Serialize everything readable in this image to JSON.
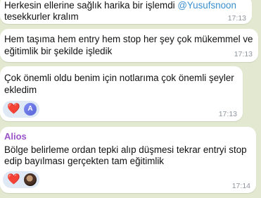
{
  "messages": [
    {
      "line1_prefix": "Herkesin ellerine sağlık harika bir işlemdi ",
      "mention": "@Yusufsnoon",
      "line2": "tesekkurler kralım",
      "time": "17:13"
    },
    {
      "line1": "Hem taşıma hem entry hem stop her şey çok mükemmel ve",
      "line2": "eğitimlik bir şekilde işledik",
      "time": "17:13"
    },
    {
      "line1": "Çok önemli oldu benim için notlarıma çok önemli şeyler",
      "line2": "ekledim",
      "time": "17:13",
      "reaction": {
        "emoji": "❤️",
        "avatar_letter": "A",
        "avatar_color": "#6b77e6"
      }
    },
    {
      "sender": "Alios",
      "sender_color": "#9a54c8",
      "line1": "Bölge belirleme ordan tepki alıp düşmesi tekrar entryi stop",
      "line2": "edip bayılması gerçekten tam eğitimlik",
      "time": "17:14",
      "reaction": {
        "emoji": "❤️",
        "avatar_icon": "user-photo-avatar"
      }
    }
  ],
  "colors": {
    "chat_background": "#e3e9d0",
    "bubble": "#ffffff",
    "mention": "#3a8fcf",
    "time": "#8e959d",
    "reaction_background": "#dfe9f6",
    "heart": "#e2343c"
  }
}
